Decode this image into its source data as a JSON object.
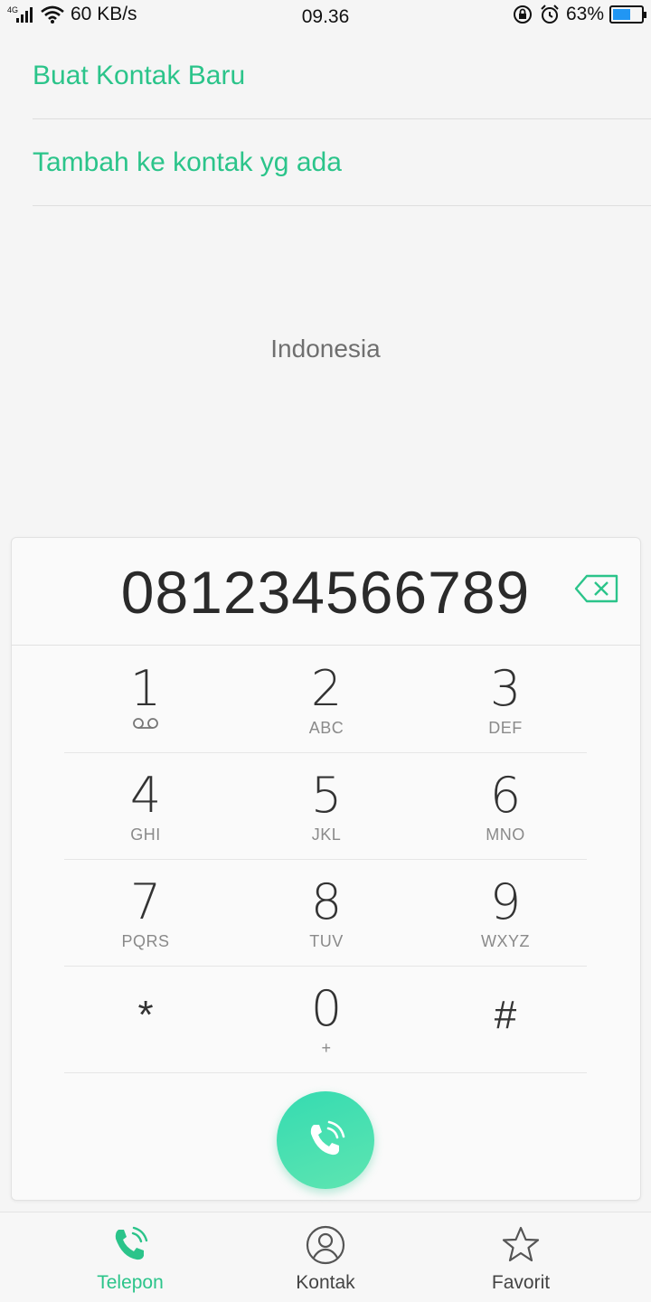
{
  "status_bar": {
    "network_type": "4G",
    "speed": "60 KB/s",
    "time": "09.36",
    "battery_percent_label": "63%",
    "battery_level": 0.63
  },
  "options": {
    "create_contact": "Buat Kontak Baru",
    "add_to_existing": "Tambah ke kontak yg ada"
  },
  "location": "Indonesia",
  "dialer": {
    "number": "081234566789",
    "keys": [
      {
        "digit": "1",
        "letters": ""
      },
      {
        "digit": "2",
        "letters": "ABC"
      },
      {
        "digit": "3",
        "letters": "DEF"
      },
      {
        "digit": "4",
        "letters": "GHI"
      },
      {
        "digit": "5",
        "letters": "JKL"
      },
      {
        "digit": "6",
        "letters": "MNO"
      },
      {
        "digit": "7",
        "letters": "PQRS"
      },
      {
        "digit": "8",
        "letters": "TUV"
      },
      {
        "digit": "9",
        "letters": "WXYZ"
      },
      {
        "digit": "*",
        "letters": ""
      },
      {
        "digit": "0",
        "letters": "+"
      },
      {
        "digit": "#",
        "letters": ""
      }
    ]
  },
  "bottom_nav": {
    "items": [
      {
        "label": "Telepon",
        "icon": "phone-icon",
        "active": true
      },
      {
        "label": "Kontak",
        "icon": "person-icon",
        "active": false
      },
      {
        "label": "Favorit",
        "icon": "star-icon",
        "active": false
      }
    ]
  },
  "colors": {
    "accent": "#2bc48a",
    "call_button": "#35dbb1",
    "battery": "#2196f3"
  }
}
